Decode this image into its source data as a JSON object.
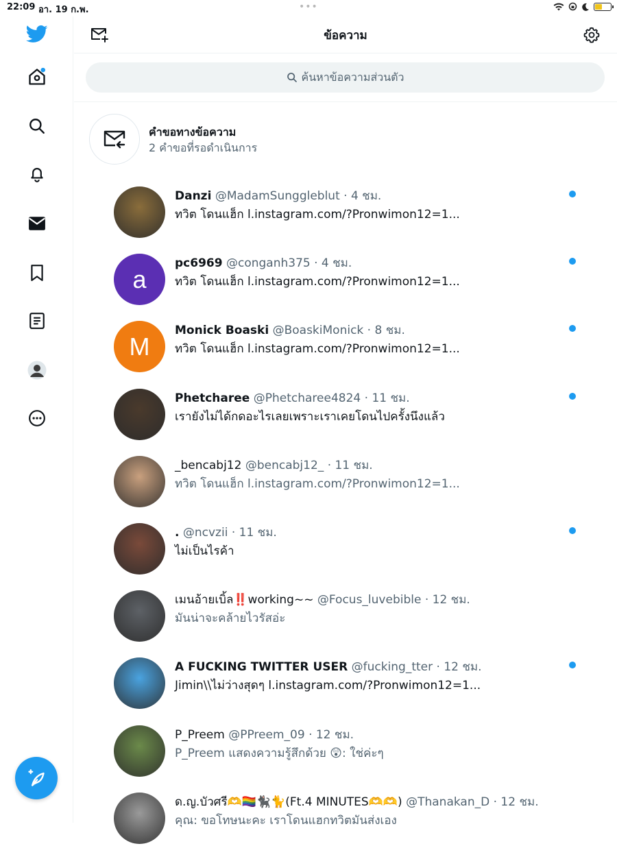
{
  "status_bar": {
    "time": "22:09",
    "date": "อา. 19 ก.พ.",
    "dots": "•••"
  },
  "colors": {
    "accent": "#1d9bf0",
    "secondary_text": "#536471",
    "divider": "#eff3f4"
  },
  "sidebar": {
    "items": [
      {
        "icon": "twitter-logo-icon"
      },
      {
        "icon": "home-icon",
        "has_notification_dot": true
      },
      {
        "icon": "search-icon"
      },
      {
        "icon": "bell-icon"
      },
      {
        "icon": "envelope-icon",
        "active": true
      },
      {
        "icon": "bookmark-icon"
      },
      {
        "icon": "lists-icon"
      },
      {
        "icon": "profile-avatar-icon"
      },
      {
        "icon": "more-icon"
      }
    ],
    "compose_icon": "compose-tweet-icon"
  },
  "header": {
    "title": "ข้อความ",
    "new_message_icon": "new-message-icon",
    "settings_icon": "gear-icon"
  },
  "search": {
    "placeholder": "ค้นหาข้อความส่วนตัว"
  },
  "message_requests": {
    "title": "คำขอทางข้อความ",
    "subtitle": "2 คำขอที่รอดำเนินการ"
  },
  "conversations": [
    {
      "name": "Danzi",
      "handle": "@MadamSunggleblut",
      "time": "· 4 ชม.",
      "preview": "ทวิต โดนแฮ็ก l.instagram.com/?Pronwimon12=1...",
      "unread": true,
      "avatar_color": "#8a6d3b"
    },
    {
      "name": "pc6969",
      "handle": "@conganh375",
      "time": "· 4 ชม.",
      "preview": "ทวิต โดนแฮ็ก l.instagram.com/?Pronwimon12=1...",
      "unread": true,
      "avatar_letter": "a",
      "avatar_color": "#5b2fb3"
    },
    {
      "name": "Monick Boaski",
      "handle": "@BoaskiMonick",
      "time": "· 8 ชม.",
      "preview": "ทวิต โดนแฮ็ก l.instagram.com/?Pronwimon12=1...",
      "unread": true,
      "avatar_letter": "M",
      "avatar_color": "#f07c11"
    },
    {
      "name": "Phetcharee",
      "handle": "@Phetcharee4824",
      "time": "· 11 ชม.",
      "preview": "เรายังไม่ได้กดอะไรเลยเพราะเราเคยโดนไปครั้งนึงแล้ว",
      "unread": true,
      "avatar_color": "#4a3a2c"
    },
    {
      "name": "_bencabj12",
      "handle": "@bencabj12_",
      "time": "· 11 ชม.",
      "preview": "ทวิต โดนแฮ็ก l.instagram.com/?Pronwimon12=1...",
      "unread": false,
      "avatar_color": "#c9a07e"
    },
    {
      "name": ".",
      "handle": "@ncvzii",
      "time": "· 11 ชม.",
      "preview": "ไม่เป็นไรค้า",
      "unread": true,
      "avatar_color": "#7a4a3a"
    },
    {
      "name": "เมนอ้ายเบิ้ล‼️working~~",
      "handle": "@Focus_luvebible",
      "time": "· 12 ชม.",
      "preview": "มันน่าจะคล้ายไวรัสอ่ะ",
      "unread": false,
      "avatar_color": "#5d6166"
    },
    {
      "name": "A FUCKING TWITTER USER",
      "handle": "@fucking_tter",
      "time": "· 12 ชม.",
      "preview": "Jimin\\\\ไม่ว่างสุดๆ l.instagram.com/?Pronwimon12=1...",
      "unread": true,
      "avatar_color": "#4aa3e0"
    },
    {
      "name": "P_Preem",
      "handle": "@PPreem_09",
      "time": "· 12 ชม.",
      "preview": "P_Preem แสดงความรู้สึกด้วย 😲: ใช่ค่ะๆ",
      "unread": false,
      "avatar_color": "#6b8a4a"
    },
    {
      "name": "ด.ญ.บัวศรี🫶🏳️‍🌈🐈‍⬛🐈(Ft.4 MINUTES🫶🫶)",
      "handle": "@Thanakan_D",
      "time": "· 12 ชม.",
      "preview": "คุณ: ขอโทษนะคะ เราโดนแฮกทวิตมันส่งเอง",
      "unread": false,
      "avatar_color": "#9a9a9a"
    }
  ]
}
